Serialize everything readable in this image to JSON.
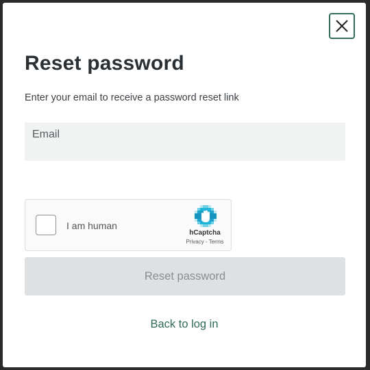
{
  "modal": {
    "title": "Reset password",
    "subtitle": "Enter your email to receive a password reset link",
    "close_icon": "close-icon"
  },
  "email": {
    "label": "Email",
    "value": ""
  },
  "captcha": {
    "label": "I am human",
    "brand": "hCaptcha",
    "privacy": "Privacy",
    "separator": " - ",
    "terms": "Terms",
    "logo_icon": "hcaptcha-logo-icon",
    "checked": false
  },
  "submit": {
    "label": "Reset password",
    "disabled": true
  },
  "back_link": {
    "label": "Back to log in"
  },
  "colors": {
    "accent": "#2f6b57",
    "field_bg": "#f1f3f2",
    "disabled_bg": "#dfe0e2",
    "disabled_text": "#8a8d91",
    "captcha_blue": "#1fb5d8"
  }
}
